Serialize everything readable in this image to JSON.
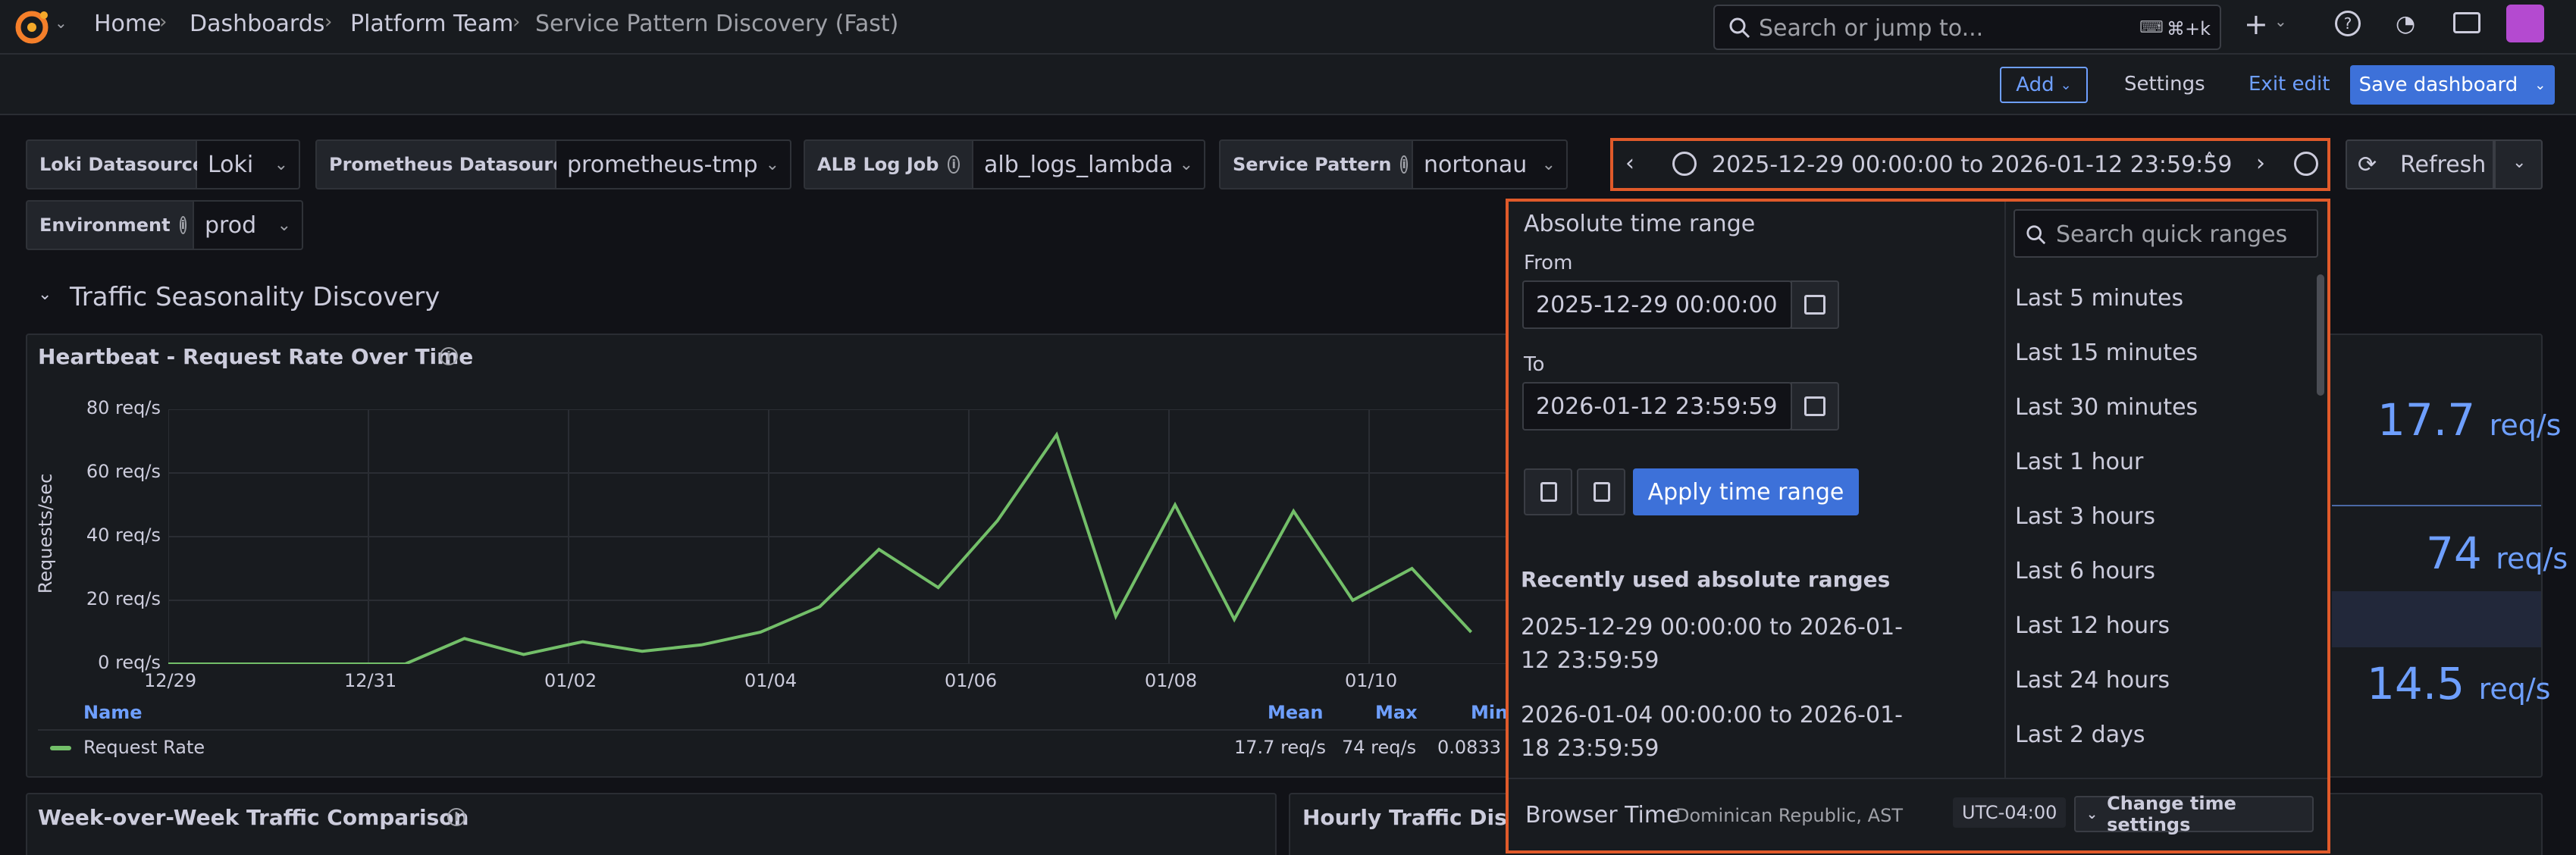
{
  "breadcrumbs": [
    "Home",
    "Dashboards",
    "Platform Team",
    "Service Pattern Discovery (Fast)"
  ],
  "search": {
    "placeholder": "Search or jump to...",
    "shortcut": "⌘+k"
  },
  "toolbar": {
    "add_label": "Add",
    "settings_label": "Settings",
    "exit_edit_label": "Exit edit",
    "save_label": "Save dashboard"
  },
  "variables": [
    {
      "label": "Loki Datasource",
      "value": "Loki",
      "info": false
    },
    {
      "label": "Prometheus Datasource",
      "value": "prometheus-tmp",
      "info": false
    },
    {
      "label": "ALB Log Job",
      "value": "alb_logs_lambda",
      "info": true
    },
    {
      "label": "Service Pattern",
      "value": "nortonau",
      "info": true
    },
    {
      "label": "Environment",
      "value": "prod",
      "info": true
    }
  ],
  "time_range": {
    "display": "2025-12-29 00:00:00 to 2026-01-12 23:59:59",
    "refresh_label": "Refresh"
  },
  "row": {
    "title": "Traffic Seasonality Discovery"
  },
  "heartbeat": {
    "title": "Heartbeat - Request Rate Over Time",
    "ylabel": "Requests/sec",
    "legend": {
      "name_header": "Name",
      "mean_header": "Mean",
      "max_header": "Max",
      "min_header": "Min",
      "series": "Request Rate",
      "mean": "17.7 req/s",
      "max": "74 req/s",
      "min": "0.0833"
    }
  },
  "chart_data": {
    "type": "line",
    "title": "Heartbeat - Request Rate Over Time",
    "ylabel": "Requests/sec",
    "y_ticks": [
      "0 req/s",
      "20 req/s",
      "40 req/s",
      "60 req/s",
      "80 req/s"
    ],
    "x_ticks": [
      "12/29",
      "12/31",
      "01/02",
      "01/04",
      "01/06",
      "01/08",
      "01/10"
    ],
    "ylim": [
      0,
      80
    ],
    "series": [
      {
        "name": "Request Rate",
        "color": "#73bf69",
        "x": [
          "12/29",
          "12/30",
          "12/31",
          "01/01",
          "01/02",
          "01/02 12h",
          "01/03",
          "01/03 12h",
          "01/04",
          "01/04 12h",
          "01/05",
          "01/05 12h",
          "01/06",
          "01/06 12h",
          "01/07",
          "01/07 12h",
          "01/08",
          "01/08 12h",
          "01/09",
          "01/09 12h",
          "01/10",
          "01/10 12h",
          "01/11"
        ],
        "values": [
          0,
          0,
          0,
          0,
          0,
          8,
          3,
          7,
          4,
          6,
          10,
          18,
          36,
          24,
          45,
          72,
          15,
          50,
          14,
          48,
          20,
          30,
          10
        ]
      }
    ]
  },
  "stats": [
    {
      "value": "17.7",
      "unit": "req/s"
    },
    {
      "value": "74",
      "unit": "req/s"
    },
    {
      "value": "14.5",
      "unit": "req/s"
    }
  ],
  "panels": {
    "week_over_week": "Week-over-Week Traffic Comparison",
    "hourly": "Hourly Traffic Distri"
  },
  "picker": {
    "heading": "Absolute time range",
    "from_label": "From",
    "from_value": "2025-12-29 00:00:00",
    "to_label": "To",
    "to_value": "2026-01-12 23:59:59",
    "apply_label": "Apply time range",
    "recent_heading": "Recently used absolute ranges",
    "recent": [
      "2025-12-29 00:00:00 to 2026-01-12 23:59:59",
      "2026-01-04 00:00:00 to 2026-01-18 23:59:59"
    ],
    "quick_search_placeholder": "Search quick ranges",
    "quick_ranges": [
      "Last 5 minutes",
      "Last 15 minutes",
      "Last 30 minutes",
      "Last 1 hour",
      "Last 3 hours",
      "Last 6 hours",
      "Last 12 hours",
      "Last 24 hours",
      "Last 2 days"
    ],
    "browser_time_label": "Browser Time",
    "timezone_name": "Dominican Republic, AST",
    "utc_offset": "UTC-04:00",
    "change_settings_label": "Change time settings"
  },
  "colors": {
    "accent": "#3d71d9",
    "series": "#73bf69",
    "highlight": "#e05a2a",
    "stat": "#6e9fff"
  }
}
